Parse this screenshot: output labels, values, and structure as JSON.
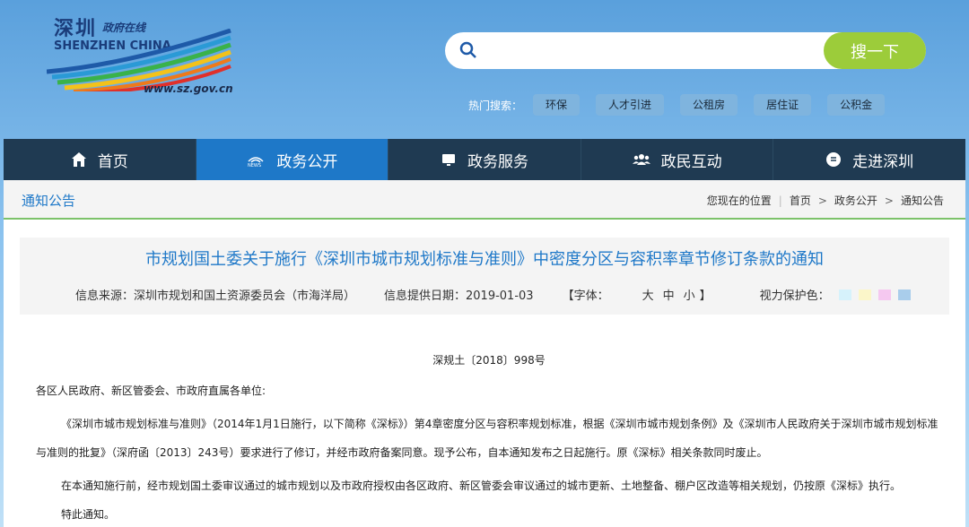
{
  "logo": {
    "title_cn": "深圳",
    "subtitle_cn": "政府在线",
    "title_en": "SHENZHEN CHINA",
    "url": "www.sz.gov.cn"
  },
  "search": {
    "placeholder": "",
    "button_label": "搜一下"
  },
  "hot_search": {
    "label": "热门搜索：",
    "tags": [
      "环保",
      "人才引进",
      "公租房",
      "居住证",
      "公积金"
    ]
  },
  "nav": {
    "items": [
      {
        "label": "首页",
        "icon": "home-icon",
        "active": false
      },
      {
        "label": "政务公开",
        "icon": "news-icon",
        "active": true
      },
      {
        "label": "政务服务",
        "icon": "monitor-icon",
        "active": false
      },
      {
        "label": "政民互动",
        "icon": "users-icon",
        "active": false
      },
      {
        "label": "走进深圳",
        "icon": "info-icon",
        "active": false
      }
    ]
  },
  "breadcrumb": {
    "section_title": "通知公告",
    "location_label": "您现在的位置",
    "items": [
      "首页",
      "政务公开",
      "通知公告"
    ]
  },
  "article": {
    "title": "市规划国土委关于施行《深圳市城市规划标准与准则》中密度分区与容积率章节修订条款的通知",
    "source": "信息来源：深圳市规划和国土资源委员会（市海洋局）",
    "date": "信息提供日期：2019-01-03",
    "font_label": "【字体：",
    "font_sizes": [
      "大",
      "中",
      "小"
    ],
    "font_close": "】",
    "eye_label": "视力保护色：",
    "eye_colors": [
      "#d6f2fb",
      "#fbf6c9",
      "#f5c8f0",
      "#a9cdeb"
    ],
    "doc_number": "深规土〔2018〕998号",
    "recipients": "各区人民政府、新区管委会、市政府直属各单位:",
    "paragraph1": "《深圳市城市规划标准与准则》（2014年1月1日施行，以下简称《深标》）第4章密度分区与容积率规划标准，根据《深圳市城市规划条例》及《深圳市人民政府关于深圳市城市规划标准与准则的批复》（深府函〔2013〕243号）要求进行了修订，并经市政府备案同意。现予公布，自本通知发布之日起施行。原《深标》相关条款同时废止。",
    "paragraph2": "在本通知施行前，经市规划国土委审议通过的城市规划以及市政府授权由各区政府、新区管委会审议通过的城市更新、土地整备、棚户区改造等相关规划，仍按原《深标》执行。",
    "closing": "特此通知。"
  },
  "colors": {
    "nav_bg": "#1f3a52",
    "nav_active": "#1e78c8",
    "accent_green": "#9ccc3a",
    "title_blue": "#1e78c8"
  }
}
